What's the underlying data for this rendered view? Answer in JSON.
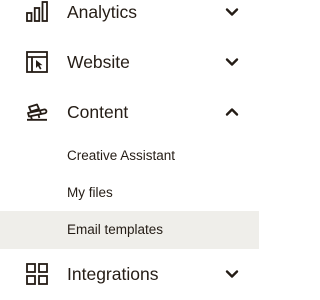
{
  "nav": {
    "analytics": {
      "label": "Analytics",
      "icon": "bar-chart-icon",
      "chevron": "chevron-down-icon"
    },
    "website": {
      "label": "Website",
      "icon": "website-icon",
      "chevron": "chevron-down-icon"
    },
    "content": {
      "label": "Content",
      "icon": "content-icon",
      "chevron": "chevron-up-icon",
      "expanded": true,
      "subitems": [
        {
          "label": "Creative Assistant",
          "active": false
        },
        {
          "label": "My files",
          "active": false
        },
        {
          "label": "Email templates",
          "active": true
        }
      ]
    },
    "integrations": {
      "label": "Integrations",
      "icon": "integrations-icon",
      "chevron": "chevron-down-icon"
    }
  },
  "colors": {
    "text": "#241c15",
    "active_background": "#efeeea",
    "background": "#ffffff"
  }
}
